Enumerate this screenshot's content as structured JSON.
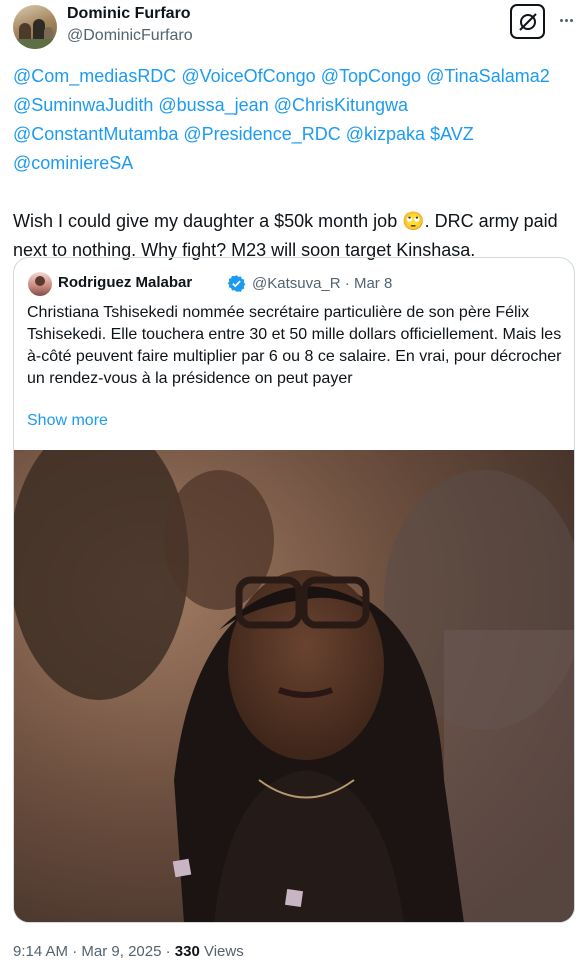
{
  "tweet": {
    "author_name": "Dominic Furfaro",
    "author_handle": "@DominicFurfaro",
    "mentions": [
      "@Com_mediasRDC",
      "@VoiceOfCongo",
      "@TopCongo",
      "@TinaSalama2",
      "@SuminwaJudith",
      "@bussa_jean",
      "@ChrisKitungwa",
      "@ConstantMutamba",
      "@Presidence_RDC",
      "@kizpaka",
      "$AVZ",
      "@cominiereSA"
    ],
    "text_part1": "Wish I could give my daughter a $50k month job",
    "emoji": "🙄",
    "text_part2": ". DRC army paid next to nothing. Why fight? M23 will soon target Kinshasa.",
    "time": "9:14 AM",
    "date": "Mar 9, 2025",
    "views_count": "330",
    "views_label": "Views"
  },
  "quote": {
    "author_name": "Rodriguez Malabar",
    "author_handle": "@Katsuva_R",
    "date": "Mar 8",
    "text": "Christiana Tshisekedi nommée secrétaire particulière de son père Félix Tshisekedi. Elle touchera entre 30 et 50 mille dollars officiellement. Mais les à-côté peuvent faire multiplier par 6 ou 8 ce salaire. En vrai, pour décrocher un rendez-vous à la présidence on peut payer",
    "show_more": "Show more"
  },
  "icons": {
    "grok": "grok-icon",
    "more": "more-icon",
    "verified": "verified-badge-icon"
  },
  "colors": {
    "link": "#1d9bf0",
    "secondary_text": "#536471",
    "border": "#cfd9de"
  }
}
